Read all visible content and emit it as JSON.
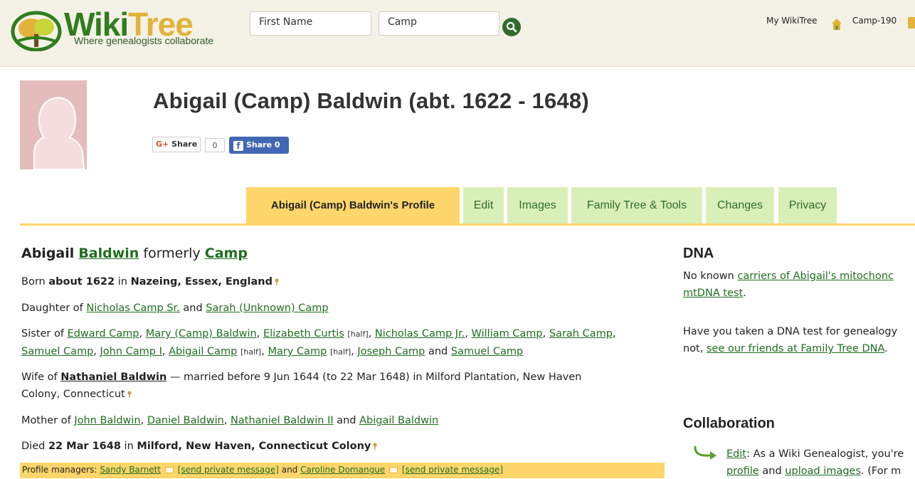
{
  "header": {
    "logo_wiki": "Wiki",
    "logo_tree": "Tree",
    "tagline": "Where genealogists collaborate",
    "search_first_placeholder": "First Name",
    "search_last_value": "Camp",
    "my_wikitree": "My WikiTree",
    "user_id": "Camp-190",
    "search_icon": "search-icon",
    "home_icon": "home-icon"
  },
  "profile": {
    "title": "Abigail (Camp) Baldwin (abt. 1622 - 1648)",
    "gplus_label": "Share",
    "gplus_count": "0",
    "fb_label": "Share 0"
  },
  "tabs": [
    {
      "label": "Abigail (Camp) Baldwin's Profile",
      "active": true
    },
    {
      "label": "Edit"
    },
    {
      "label": "Images"
    },
    {
      "label": "Family Tree & Tools"
    },
    {
      "label": "Changes"
    },
    {
      "label": "Privacy"
    }
  ],
  "bio": {
    "first_name": "Abigail",
    "surname": "Baldwin",
    "formerly": "formerly",
    "maiden": "Camp",
    "born": {
      "prefix": "Born",
      "date": "about 1622",
      "in": "in",
      "place": "Nazeing, Essex, England"
    },
    "daughter": {
      "prefix": "Daughter of",
      "father": "Nicholas Camp Sr.",
      "and": "and",
      "mother": "Sarah (Unknown) Camp"
    },
    "siblings_prefix": "Sister of",
    "siblings": [
      {
        "name": "Edward Camp",
        "half": ""
      },
      {
        "name": "Mary (Camp) Baldwin",
        "half": ""
      },
      {
        "name": "Elizabeth Curtis",
        "half": "[half]"
      },
      {
        "name": "Nicholas Camp Jr.",
        "half": ""
      },
      {
        "name": "William Camp",
        "half": ""
      },
      {
        "name": "Sarah Camp",
        "half": ""
      },
      {
        "name": "Samuel Camp",
        "half": ""
      },
      {
        "name": "John Camp I",
        "half": ""
      },
      {
        "name": "Abigail Camp",
        "half": "[half]"
      },
      {
        "name": "Mary Camp",
        "half": "[half]"
      },
      {
        "name": "Joseph Camp",
        "half": ""
      },
      {
        "name": "Samuel Camp",
        "half": ""
      }
    ],
    "wife": {
      "prefix": "Wife of",
      "husband": "Nathaniel Baldwin",
      "details_line1": "— married before 9 Jun 1644 (to 22 Mar 1648) in Milford Plantation, New Haven",
      "details_line2": "Colony, Connecticut"
    },
    "mother_prefix": "Mother of",
    "children": [
      "John Baldwin",
      "Daniel Baldwin",
      "Nathaniel Baldwin II",
      "Abigail Baldwin"
    ],
    "died": {
      "prefix": "Died",
      "date": "22 Mar 1648",
      "in": "in",
      "place": "Milford, New Haven, Connecticut Colony"
    },
    "managers": {
      "prefix": "Profile managers:",
      "manager1": "Sandy Barnett",
      "send1": "[send private message]",
      "and": "and",
      "manager2": "Caroline Domangue",
      "send2": "[send private message]"
    }
  },
  "sidebar": {
    "dna_title": "DNA",
    "dna_line1_prefix": "No known",
    "dna_line1_link": "carriers of Abigail's mitochonc",
    "dna_line2_link": "mtDNA test",
    "dna_line2_suffix": ".",
    "dna_line3": "Have you taken a DNA test for genealogy",
    "dna_line4_prefix": "not,",
    "dna_line4_link": "see our friends at Family Tree DNA",
    "dna_line4_suffix": ".",
    "collab_title": "Collaboration",
    "collab_edit_link": "Edit",
    "collab_line1_suffix": ": As a Wiki Genealogist, you're",
    "collab_line2_link1": "profile",
    "collab_line2_and": "and",
    "collab_line2_link2": "upload images",
    "collab_line2_suffix": ". (For m"
  },
  "colors": {
    "header_bg": "#f4f1e6",
    "tab_active": "#ffd66b",
    "tab_inactive": "#d9efb8",
    "link": "#1f6e1f"
  }
}
